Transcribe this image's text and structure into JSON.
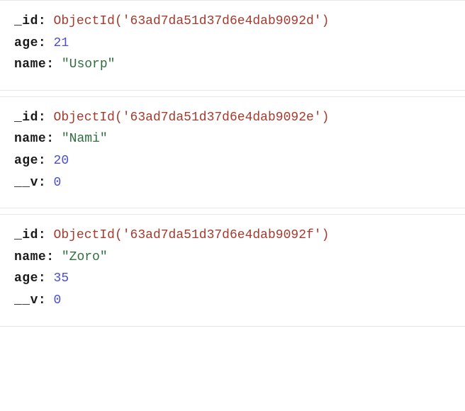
{
  "documents": [
    {
      "fields": [
        {
          "key": "_id",
          "type": "objectid",
          "value": "ObjectId('63ad7da51d37d6e4dab9092d')"
        },
        {
          "key": "age",
          "type": "number",
          "value": "21"
        },
        {
          "key": "name",
          "type": "string",
          "value": "\"Usorp\""
        }
      ]
    },
    {
      "fields": [
        {
          "key": "_id",
          "type": "objectid",
          "value": "ObjectId('63ad7da51d37d6e4dab9092e')"
        },
        {
          "key": "name",
          "type": "string",
          "value": "\"Nami\""
        },
        {
          "key": "age",
          "type": "number",
          "value": "20"
        },
        {
          "key": "__v",
          "type": "number",
          "value": "0"
        }
      ]
    },
    {
      "fields": [
        {
          "key": "_id",
          "type": "objectid",
          "value": "ObjectId('63ad7da51d37d6e4dab9092f')"
        },
        {
          "key": "name",
          "type": "string",
          "value": "\"Zoro\""
        },
        {
          "key": "age",
          "type": "number",
          "value": "35"
        },
        {
          "key": "__v",
          "type": "number",
          "value": "0"
        }
      ]
    }
  ]
}
